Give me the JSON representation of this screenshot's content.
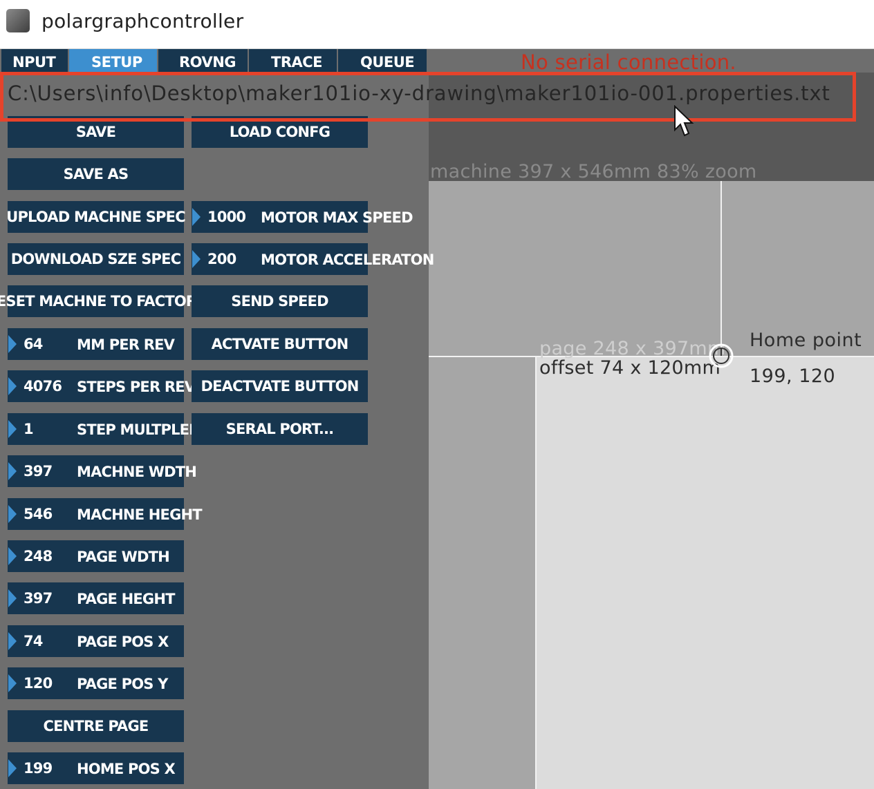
{
  "window": {
    "title": "polargraphcontroller"
  },
  "tabs": [
    {
      "label": "NPUT"
    },
    {
      "label": "SETUP"
    },
    {
      "label": "ROVNG"
    },
    {
      "label": "TRACE"
    },
    {
      "label": "QUEUE"
    }
  ],
  "status": {
    "serial": "No serial connection."
  },
  "properties_path": "C:\\Users\\info\\Desktop\\maker101io-xy-drawing\\maker101io-001.properties.txt",
  "left_column": {
    "save": "SAVE",
    "save_as": "SAVE AS",
    "upload_spec": "UPLOAD MACHNE SPEC",
    "download_spec": "DOWNLOAD SZE SPEC",
    "reset_factory": "RESET MACHNE TO FACTORY",
    "mm_per_rev": {
      "value": "64",
      "label": "MM PER REV"
    },
    "steps_per_rev": {
      "value": "4076",
      "label": "STEPS PER REV"
    },
    "step_multiplier": {
      "value": "1",
      "label": "STEP MULTPLER"
    },
    "machine_width": {
      "value": "397",
      "label": "MACHNE WDTH"
    },
    "machine_height": {
      "value": "546",
      "label": "MACHNE HEGHT"
    },
    "page_width": {
      "value": "248",
      "label": "PAGE WDTH"
    },
    "page_height": {
      "value": "397",
      "label": "PAGE HEGHT"
    },
    "page_pos_x": {
      "value": "74",
      "label": "PAGE POS X"
    },
    "page_pos_y": {
      "value": "120",
      "label": "PAGE POS Y"
    },
    "centre_page": "CENTRE PAGE",
    "home_pos_x": {
      "value": "199",
      "label": "HOME POS X"
    }
  },
  "right_column": {
    "load_config": "LOAD CONFG",
    "motor_max_speed": {
      "value": "1000",
      "label": "MOTOR MAX SPEED"
    },
    "motor_acceleration": {
      "value": "200",
      "label": "MOTOR ACCELERATON"
    },
    "send_speed": "SEND SPEED",
    "activate_button": "ACTVATE BUTTON",
    "deactivate_button": "DEACTVATE BUTTON",
    "serial_port": "SERAL PORT..."
  },
  "canvas": {
    "machine_label": "machine 397 x 546mm 83% zoom",
    "page_label": "page 248 x 397mm",
    "offset_label": "offset 74 x 120mm",
    "home_label": "Home point",
    "home_coords": "199, 120"
  },
  "colors": {
    "button_bg": "#17364f",
    "active_tab": "#3d8fcf",
    "serial_error": "#c7311f",
    "highlight": "#e5432b"
  }
}
